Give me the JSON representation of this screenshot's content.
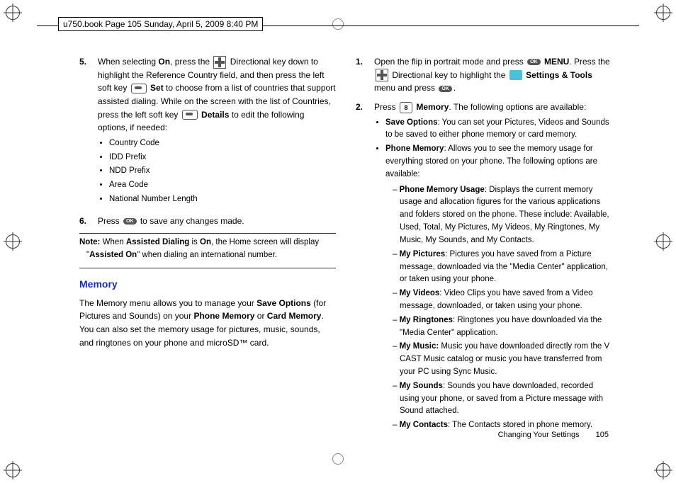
{
  "header": "u750.book  Page 105  Sunday, April 5, 2009  8:40 PM",
  "left": {
    "step5": {
      "num": "5.",
      "pre": "When selecting ",
      "on": "On",
      "mid1": ", press the ",
      "mid2": " Directional key down to highlight the Reference Country field, and then press the left soft key ",
      "set": " Set",
      "mid3": " to choose from a list of countries that support assisted dialing. While on the screen with the list of Countries, press the left soft key ",
      "details": " Details",
      "post": " to edit the following options, if needed:"
    },
    "bullets": [
      "Country Code",
      "IDD Prefix",
      "NDD Prefix",
      "Area Code",
      "National Number Length"
    ],
    "step6": {
      "num": "6.",
      "pre": "Press ",
      "post": " to save any changes made."
    },
    "note_label": "Note:",
    "note_text1": " When ",
    "note_ad": "Assisted Dialing",
    "note_text2": " is ",
    "note_on": "On",
    "note_text3": ", the Home screen will display \"",
    "note_ao": "Assisted On",
    "note_text4": "\" when dialing an international number.",
    "heading": "Memory",
    "para_pre": "The Memory menu allows you to manage your ",
    "so": "Save Options",
    "para_mid1": " (for Pictures and Sounds) on your ",
    "pm": "Phone Memory",
    "para_mid2": " or ",
    "cm": "Card Memory",
    "para_post": ". You can also set the memory usage for pictures, music, sounds, and ringtones on your phone and microSD™ card."
  },
  "right": {
    "step1": {
      "num": "1.",
      "pre": "Open the flip in portrait mode and press ",
      "menu": " MENU",
      "mid1": ". Press the ",
      "mid2": " Directional key to highlight the ",
      "st": " Settings & Tools",
      "mid3": " menu and press ",
      "post": "."
    },
    "step2": {
      "num": "2.",
      "pre": "Press ",
      "key": "8",
      "mem": " Memory",
      "post": ". The following options are available:"
    },
    "so_label": "Save Options",
    "so_text": ": You can set your Pictures, Videos and Sounds to be saved to either phone memory or card memory.",
    "pm_label": "Phone Memory",
    "pm_text": ": Allows you to see the memory usage for everything stored on your phone. The following options are available:",
    "subs": [
      {
        "b": "Phone Memory Usage",
        "t": ": Displays the current memory usage and allocation figures for the various applications and folders stored on the phone. These include: Available, Used, Total, My Pictures, My Videos, My Ringtones, My Music, My Sounds, and  My Contacts."
      },
      {
        "b": "My Pictures",
        "t": ": Pictures you have saved from a Picture message, downloaded via the \"Media Center\" application, or taken using your phone."
      },
      {
        "b": "My Videos",
        "t": ": Video Clips you have saved from a Video message, downloaded, or taken using your phone."
      },
      {
        "b": "My Ringtones",
        "t": ": Ringtones you have downloaded via the \"Media Center\" application."
      },
      {
        "b": "My Music:",
        "t": " Music you have downloaded directly rom the V CAST Music catalog or music you have transferred from your PC using Sync Music."
      },
      {
        "b": "My Sounds",
        "t": ": Sounds you have downloaded, recorded using your phone, or saved from a Picture message with Sound attached."
      },
      {
        "b": "My Contacts",
        "t": ": The Contacts stored in phone memory."
      }
    ]
  },
  "footer": {
    "section": "Changing Your Settings",
    "page": "105"
  }
}
